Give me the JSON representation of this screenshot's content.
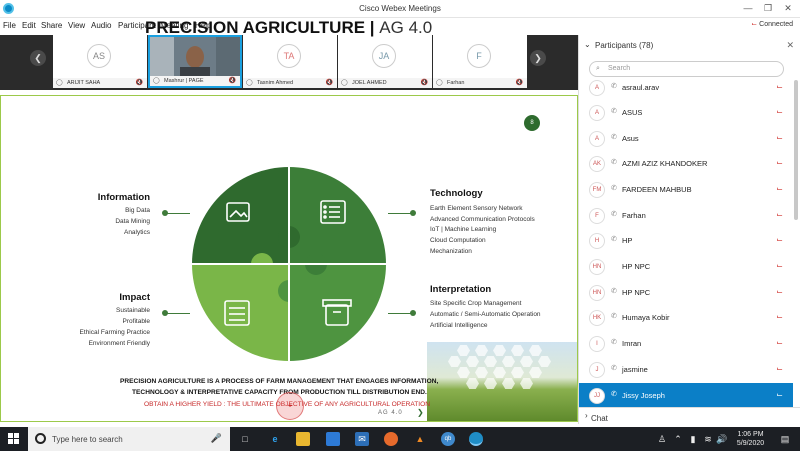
{
  "window": {
    "title": "Cisco Webex Meetings",
    "connection_status": "Connected"
  },
  "menu": [
    "File",
    "Edit",
    "Share",
    "View",
    "Audio",
    "Participant",
    "Meeting",
    "Help"
  ],
  "video_strip": {
    "tiles": [
      {
        "initials": "",
        "name": "ARIJIT SAHA",
        "is_video": false
      },
      {
        "initials": "",
        "name": "Mashrur | PAGE",
        "is_video": true
      },
      {
        "initials": "TA",
        "name": "Tasnim Ahmed",
        "is_video": false
      },
      {
        "initials": "JA",
        "name": "JOEL AHMED",
        "is_video": false
      },
      {
        "initials": "F",
        "name": "Farhan",
        "is_video": false
      }
    ]
  },
  "slide": {
    "title_bold": "PRECISION AGRICULTURE",
    "title_sep": "|",
    "title_light": "AG 4.0",
    "badge": "8",
    "information": {
      "heading": "Information",
      "items": [
        "Big Data",
        "Data Mining",
        "Analytics"
      ]
    },
    "technology": {
      "heading": "Technology",
      "items": [
        "Earth Element Sensory Network",
        "Advanced Communication Protocols",
        "IoT | Machine Learning",
        "Cloud Computation",
        "Mechanization"
      ]
    },
    "impact": {
      "heading": "Impact",
      "items": [
        "Sustainable",
        "Profitable",
        "Ethical Farming Practice",
        "Environment Friendly"
      ]
    },
    "interpretation": {
      "heading": "Interpretation",
      "items": [
        "Site Specific Crop Management",
        "Automatic / Semi-Automatic Operation",
        "Artificial Intelligence"
      ]
    },
    "footer_line1": "PRECISION AGRICULTURE IS A PROCESS OF FARM MANAGEMENT THAT ENGAGES INFORMATION,",
    "footer_line2": "TECHNOLOGY & INTERPRETATIVE CAPACITY FROM PRODUCTION TILL DISTRIBUTION END.",
    "footer_red": "OBTAIN A HIGHER YIELD : THE ULTIMATE OBJECTIVE OF ANY AGRICULTURAL OPERATION",
    "footer_mark": "AG 4.0",
    "colors": {
      "dark_green": "#2f6a2e",
      "mid_green": "#3f8a3a",
      "light_green": "#7ab648",
      "accent_red": "#c62828"
    }
  },
  "participants_panel": {
    "title": "Participants (78)",
    "search_placeholder": "Search",
    "rows": [
      {
        "initials": "A",
        "name": "asraul.arav",
        "selected": false
      },
      {
        "initials": "A",
        "name": "ASUS",
        "selected": false
      },
      {
        "initials": "A",
        "name": "Asus",
        "selected": false
      },
      {
        "initials": "AK",
        "name": "AZMI AZIZ KHANDOKER",
        "selected": false
      },
      {
        "initials": "FM",
        "name": "FARDEEN MAHBUB",
        "selected": false
      },
      {
        "initials": "F",
        "name": "Farhan",
        "selected": false
      },
      {
        "initials": "H",
        "name": "HP",
        "selected": false
      },
      {
        "initials": "HN",
        "name": "HP NPC",
        "selected": false
      },
      {
        "initials": "HN",
        "name": "HP NPC",
        "selected": false
      },
      {
        "initials": "HK",
        "name": "Humaya Kobir",
        "selected": false
      },
      {
        "initials": "I",
        "name": "Imran",
        "selected": false
      },
      {
        "initials": "J",
        "name": "jasmine",
        "selected": false
      },
      {
        "initials": "JJ",
        "name": "Jissy Joseph",
        "selected": true
      }
    ],
    "chat_label": "Chat"
  },
  "taskbar": {
    "search_placeholder": "Type here to search",
    "time": "1:06 PM",
    "date": "5/9/2020"
  }
}
